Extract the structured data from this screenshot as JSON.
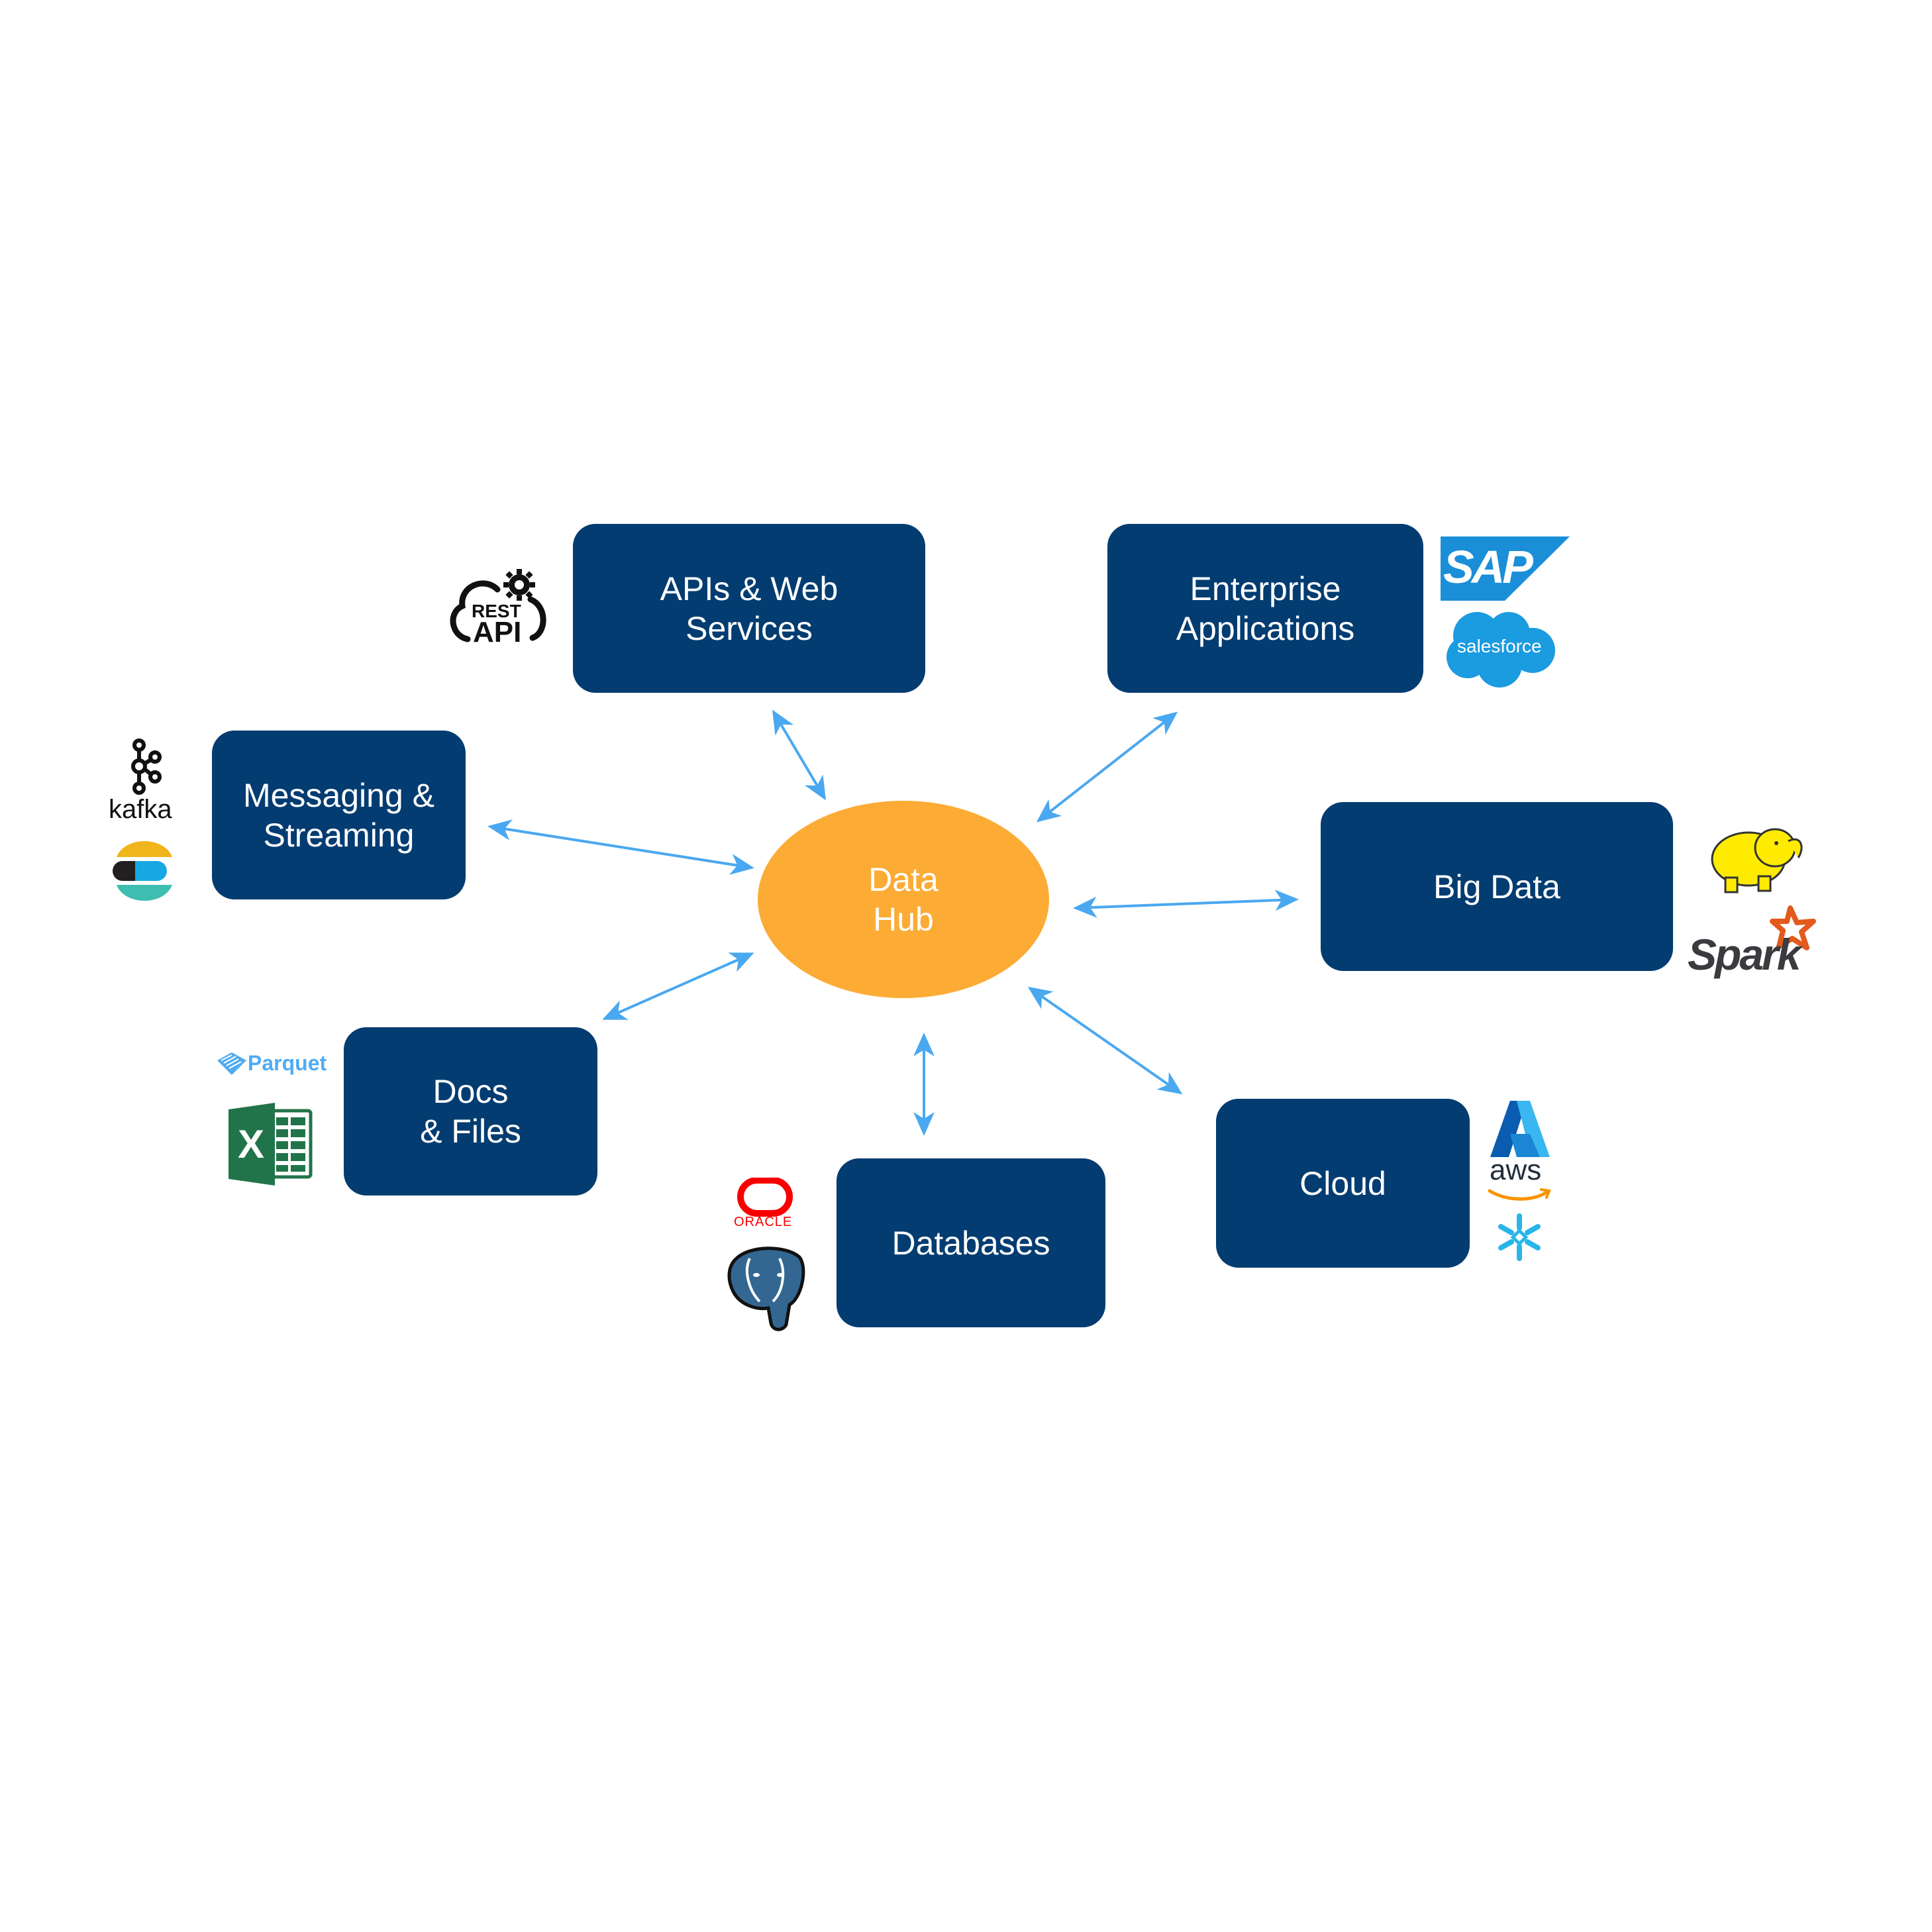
{
  "diagram": {
    "hub": {
      "label": "Data\nHub",
      "color": "#fcab35"
    },
    "node_color": "#033c71",
    "arrow_color": "#4aa8f0",
    "nodes": [
      {
        "id": "apis",
        "label": "APIs & Web\nServices",
        "logos": [
          "REST API"
        ]
      },
      {
        "id": "enterprise",
        "label": "Enterprise\nApplications",
        "logos": [
          "SAP",
          "salesforce"
        ]
      },
      {
        "id": "messaging",
        "label": "Messaging &\nStreaming",
        "logos": [
          "kafka",
          "elastic"
        ]
      },
      {
        "id": "bigdata",
        "label": "Big Data",
        "logos": [
          "hadoop",
          "Spark"
        ]
      },
      {
        "id": "docs",
        "label": "Docs\n& Files",
        "logos": [
          "Parquet",
          "excel"
        ]
      },
      {
        "id": "databases",
        "label": "Databases",
        "logos": [
          "ORACLE",
          "postgresql"
        ]
      },
      {
        "id": "cloud",
        "label": "Cloud",
        "logos": [
          "azure",
          "aws",
          "snowflake"
        ]
      }
    ],
    "edges": [
      {
        "from": "hub",
        "to": "apis",
        "direction": "bidirectional"
      },
      {
        "from": "hub",
        "to": "enterprise",
        "direction": "bidirectional"
      },
      {
        "from": "hub",
        "to": "messaging",
        "direction": "bidirectional"
      },
      {
        "from": "hub",
        "to": "bigdata",
        "direction": "bidirectional"
      },
      {
        "from": "hub",
        "to": "docs",
        "direction": "bidirectional"
      },
      {
        "from": "hub",
        "to": "databases",
        "direction": "bidirectional"
      },
      {
        "from": "hub",
        "to": "cloud",
        "direction": "bidirectional"
      }
    ],
    "logo_text": {
      "rest": "REST",
      "api": "API",
      "sap": "SAP",
      "salesforce": "salesforce",
      "kafka": "kafka",
      "spark": "Spark",
      "parquet": "Parquet",
      "excel_x": "X",
      "oracle": "ORACLE",
      "aws": "aws"
    }
  }
}
